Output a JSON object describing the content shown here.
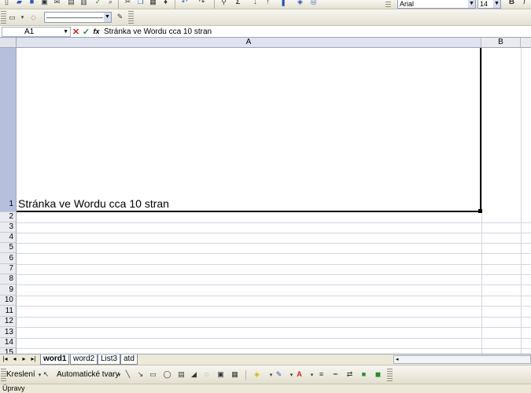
{
  "toolbar_top": {
    "font_name": "Arial",
    "font_size": "14",
    "bold_label": "B",
    "italic_label": "I"
  },
  "toolbar_lines": {
    "line_style_value": "————————"
  },
  "formula_bar": {
    "name_box": "A1",
    "cancel_symbol": "✕",
    "enter_symbol": "✓",
    "fx_label": "fx",
    "formula": "Stránka ve Wordu cca 10 stran"
  },
  "columns": [
    "A",
    "B"
  ],
  "rows": [
    "1",
    "2",
    "3",
    "4",
    "5",
    "6",
    "7",
    "8",
    "9",
    "10",
    "11",
    "12",
    "13",
    "14",
    "15"
  ],
  "cells": {
    "A1": "Stránka ve Wordu cca 10 stran"
  },
  "sheet_tabs": [
    "word1",
    "word2",
    "List3",
    "atd"
  ],
  "active_sheet": "word1",
  "drawing_toolbar": {
    "draw_label": "Kreslení",
    "autoshapes_label": "Automatické tvary"
  },
  "status_bar": {
    "text": "Úpravy"
  }
}
